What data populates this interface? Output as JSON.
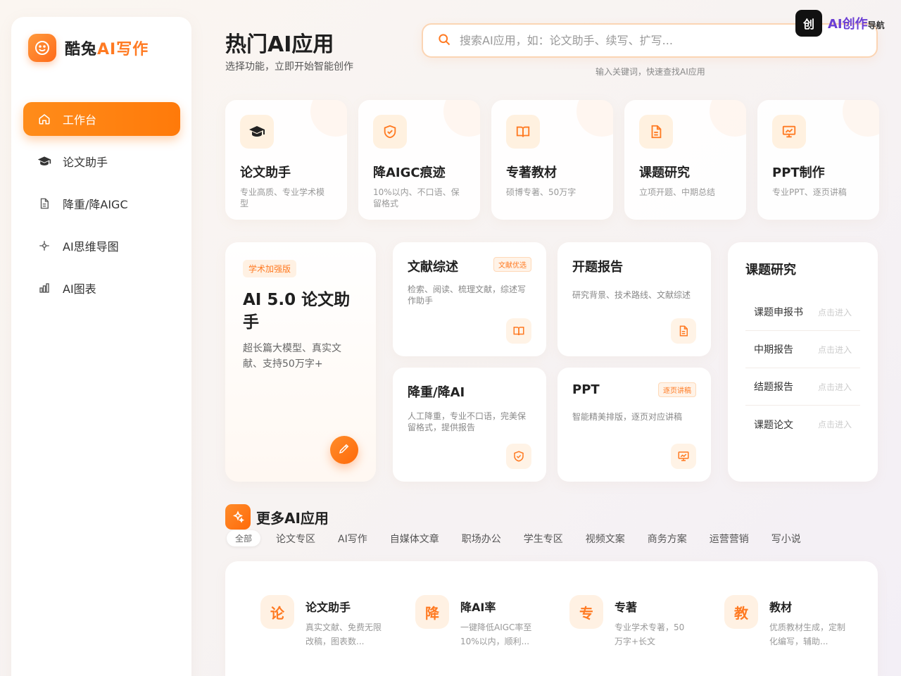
{
  "brand": {
    "name_main": "酷兔",
    "name_accent": "AI写作"
  },
  "nav": [
    {
      "label": "工作台",
      "icon": "home-icon",
      "active": true
    },
    {
      "label": "论文助手",
      "icon": "graduation-cap-icon"
    },
    {
      "label": "降重/降AIGC",
      "icon": "document-icon"
    },
    {
      "label": "AI思维导图",
      "icon": "mindmap-icon"
    },
    {
      "label": "AI图表",
      "icon": "bar-chart-icon"
    }
  ],
  "header": {
    "title": "热门AI应用",
    "subtitle": "选择功能，立即开始智能创作",
    "search_placeholder": "搜索AI应用，如：论文助手、续写、扩写...",
    "search_hint": "输入关键词，快速查找AI应用"
  },
  "corner_logo": {
    "mark": "创",
    "text": "AI创作",
    "sub": "导航"
  },
  "top_cards": [
    {
      "title": "论文助手",
      "desc": "专业高质、专业学术模型",
      "icon": "graduation-cap-icon"
    },
    {
      "title": "降AIGC痕迹",
      "desc": "10%以内、不口语、保留格式",
      "icon": "shield-icon"
    },
    {
      "title": "专著教材",
      "desc": "硕博专著、50万字",
      "icon": "book-icon"
    },
    {
      "title": "课题研究",
      "desc": "立项开题、中期总结",
      "icon": "document-icon"
    },
    {
      "title": "PPT制作",
      "desc": "专业PPT、逐页讲稿",
      "icon": "presentation-icon"
    }
  ],
  "promo": {
    "tag": "学术加强版",
    "title": "AI 5.0 论文助手",
    "desc": "超长篇大模型、真实文献、支持50万字+"
  },
  "mid_cards": [
    {
      "title": "文献综述",
      "badge": "文献优选",
      "desc": "检索、阅读、梳理文献，综述写作助手",
      "icon": "book-icon"
    },
    {
      "title": "开题报告",
      "badge": "",
      "desc": "研究背景、技术路线、文献综述",
      "icon": "document-icon"
    },
    {
      "title": "降重/降AI",
      "badge": "",
      "desc": "人工降重，专业不口语，完美保留格式，提供报告",
      "icon": "shield-icon"
    },
    {
      "title": "PPT",
      "badge": "逐页讲稿",
      "desc": "智能精美排版，逐页对应讲稿",
      "icon": "presentation-icon"
    }
  ],
  "research_panel": {
    "title": "课题研究",
    "items": [
      {
        "label": "课题申报书",
        "action": "点击进入"
      },
      {
        "label": "中期报告",
        "action": "点击进入"
      },
      {
        "label": "结题报告",
        "action": "点击进入"
      },
      {
        "label": "课题论文",
        "action": "点击进入"
      }
    ]
  },
  "more": {
    "title": "更多AI应用",
    "categories": [
      "全部",
      "论文专区",
      "AI写作",
      "自媒体文章",
      "职场办公",
      "学生专区",
      "视频文案",
      "商务方案",
      "运营营销",
      "写小说"
    ],
    "apps": [
      {
        "glyph": "论",
        "title": "论文助手",
        "desc": "真实文献、免费无限改稿，图表数..."
      },
      {
        "glyph": "降",
        "title": "降AI率",
        "desc": "一键降低AIGC率至10%以内，顺利..."
      },
      {
        "glyph": "专",
        "title": "专著",
        "desc": "专业学术专著，50万字+长文"
      },
      {
        "glyph": "教",
        "title": "教材",
        "desc": "优质教材生成，定制化编写，辅助..."
      }
    ]
  },
  "colors": {
    "accent": "#ff7a22",
    "accent_bg": "#fff1e3"
  }
}
